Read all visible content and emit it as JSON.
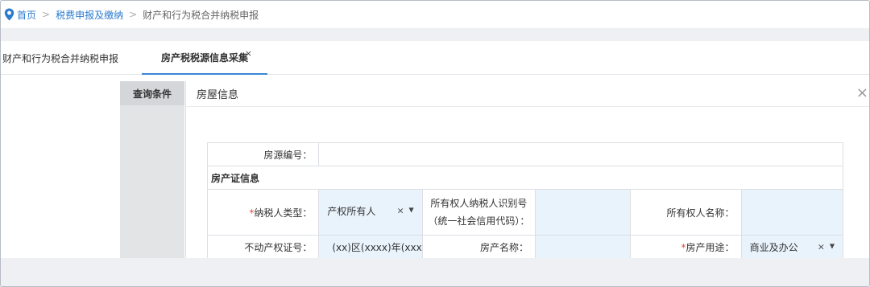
{
  "breadcrumb": {
    "home": "首页",
    "level2": "税费申报及缴纳",
    "current": "财产和行为税合并纳税申报",
    "separator": ">"
  },
  "tabs": {
    "tab1": "财产和行为税合并纳税申报",
    "tab2": "房产税税源信息采集",
    "close": "×"
  },
  "sidebar": {
    "query_tab": "查询条件"
  },
  "panel": {
    "title": "房屋信息",
    "close": "×"
  },
  "form": {
    "house_source_label": "房源编号：",
    "house_source_value": "",
    "section_title": "房产证信息",
    "required_mark": "*",
    "taxpayer_type_label": "纳税人类型：",
    "taxpayer_type_value": "产权所有人",
    "owner_taxid_label_1": "所有权人纳税人识别号",
    "owner_taxid_label_2": "（统一社会信用代码）：",
    "owner_name_label": "所有权人名称：",
    "cert_no_label": "不动产权证号：",
    "cert_no_placeholder": "(xx)区(xxxx)年(xxx",
    "house_name_label": "房产名称：",
    "house_use_label": "房产用途：",
    "house_use_value": "商业及办公",
    "clear_symbol": "×",
    "caret_symbol": "▼"
  },
  "colors": {
    "accent": "#2b7bd0",
    "required": "#e04b3b",
    "field_bg": "#e9f3fc"
  }
}
